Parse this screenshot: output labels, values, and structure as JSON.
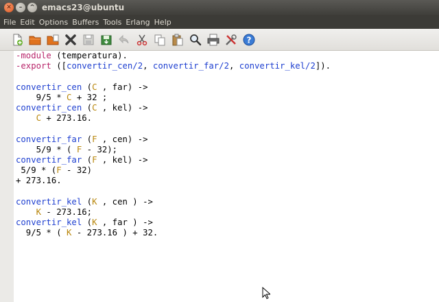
{
  "window": {
    "title": "emacs23@ubuntu"
  },
  "menu": [
    "File",
    "Edit",
    "Options",
    "Buffers",
    "Tools",
    "Erlang",
    "Help"
  ],
  "toolbar": [
    {
      "name": "new-file-icon"
    },
    {
      "name": "open-folder-icon"
    },
    {
      "name": "open-dir-icon"
    },
    {
      "name": "close-buffer-icon"
    },
    {
      "name": "save-icon"
    },
    {
      "name": "save-as-icon"
    },
    {
      "name": "undo-icon"
    },
    {
      "name": "cut-icon"
    },
    {
      "name": "copy-icon"
    },
    {
      "name": "paste-icon"
    },
    {
      "name": "search-icon"
    },
    {
      "name": "print-icon"
    },
    {
      "name": "preferences-icon"
    },
    {
      "name": "help-icon"
    }
  ],
  "code": [
    [
      [
        "kw",
        "-module"
      ],
      [
        "t",
        " (temperatura)."
      ]
    ],
    [
      [
        "kw",
        "-export"
      ],
      [
        "t",
        " (["
      ],
      [
        "fn",
        "convertir_cen/2"
      ],
      [
        "t",
        ", "
      ],
      [
        "fn",
        "convertir_far/2"
      ],
      [
        "t",
        ", "
      ],
      [
        "fn",
        "convertir_kel/2"
      ],
      [
        "t",
        "])."
      ]
    ],
    [],
    [
      [
        "fn",
        "convertir_cen"
      ],
      [
        "t",
        " ("
      ],
      [
        "var",
        "C"
      ],
      [
        "t",
        " , far) ->"
      ]
    ],
    [
      [
        "t",
        "    9/5 * "
      ],
      [
        "var",
        "C"
      ],
      [
        "t",
        " + 32 ;"
      ]
    ],
    [
      [
        "fn",
        "convertir_cen"
      ],
      [
        "t",
        " ("
      ],
      [
        "var",
        "C"
      ],
      [
        "t",
        " , kel) ->"
      ]
    ],
    [
      [
        "t",
        "    "
      ],
      [
        "var",
        "C"
      ],
      [
        "t",
        " + 273.16."
      ]
    ],
    [],
    [
      [
        "fn",
        "convertir_far"
      ],
      [
        "t",
        " ("
      ],
      [
        "var",
        "F"
      ],
      [
        "t",
        " , cen) ->"
      ]
    ],
    [
      [
        "t",
        "    5/9 * ( "
      ],
      [
        "var",
        "F"
      ],
      [
        "t",
        " - 32);"
      ]
    ],
    [
      [
        "fn",
        "convertir_far"
      ],
      [
        "t",
        " ("
      ],
      [
        "var",
        "F"
      ],
      [
        "t",
        " , kel) ->"
      ]
    ],
    [
      [
        "t",
        " 5/9 * ("
      ],
      [
        "var",
        "F"
      ],
      [
        "t",
        " - 32)"
      ]
    ],
    [
      [
        "t",
        "+ 273.16."
      ]
    ],
    [],
    [
      [
        "fn",
        "convertir_kel"
      ],
      [
        "t",
        " ("
      ],
      [
        "var",
        "K"
      ],
      [
        "t",
        " , cen ) ->"
      ]
    ],
    [
      [
        "t",
        "    "
      ],
      [
        "var",
        "K"
      ],
      [
        "t",
        " - 273.16;"
      ]
    ],
    [
      [
        "fn",
        "convertir_kel"
      ],
      [
        "t",
        " ("
      ],
      [
        "var",
        "K"
      ],
      [
        "t",
        " , far ) ->"
      ]
    ],
    [
      [
        "t",
        "  9/5 * ( "
      ],
      [
        "var",
        "K"
      ],
      [
        "t",
        " - 273.16 ) + 32."
      ]
    ]
  ]
}
